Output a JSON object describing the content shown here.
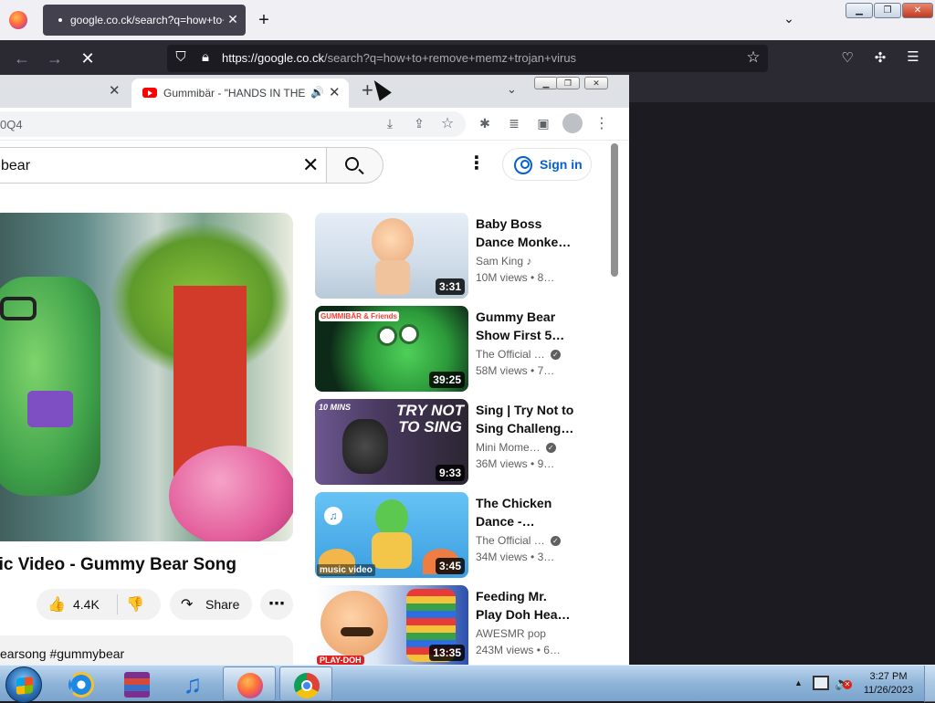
{
  "firefox": {
    "tab": {
      "title": "google.co.ck/search?q=how+to+remove+memz+trojan+virus",
      "close": "✕"
    },
    "new_tab": "+",
    "list_tabs": "⌄",
    "window_controls": {
      "minimize": "▁",
      "maximize": "❐",
      "close": "✕"
    },
    "nav": {
      "back": "←",
      "forward": "→",
      "stop": "✕"
    },
    "url": {
      "host": "https://google.co.ck",
      "path": "/search?q=how+to+remove+memz+trojan+virus"
    },
    "icons": {
      "shield": "shield-icon",
      "lock": "lock-icon",
      "bookmark": "☆",
      "pocket": "pocket-icon",
      "extensions": "puzzle-icon",
      "menu": "☰"
    }
  },
  "chrome": {
    "prev_tab_close": "✕",
    "tab": {
      "title": "Gummibär - \"HANDS IN THE AIR\"",
      "audio": "🔊",
      "close": "✕"
    },
    "new_tab": "+",
    "tab_search": "⌄",
    "window_controls": {
      "minimize": "▁",
      "maximize": "❐",
      "close": "✕"
    },
    "omnibox_text": "0Q4",
    "toolbar_icons": {
      "install": "⤓",
      "share": "⇪",
      "star": "☆",
      "extensions": "✱",
      "media": "≣",
      "sidepanel": "▣",
      "menu": "⋮"
    }
  },
  "youtube": {
    "search_query": "bear",
    "search_clear": "✕",
    "more": "⋮",
    "sign_in": "Sign in",
    "video_title": "sic Video - Gummy Bear Song",
    "like_count": "4.4K",
    "like_icon": "👍",
    "dislike_icon": "👎",
    "share": "Share",
    "share_icon": "↷",
    "actions_more": "⋯",
    "description_tags": "earsong #gummybear",
    "recommendations": [
      {
        "title": "Baby Boss Dance Monke…",
        "channel": "Sam King ♪",
        "verified": false,
        "views": "10M views",
        "age": "• 8…",
        "duration": "3:31",
        "thumb_colors": [
          "#dbe7f1",
          "#f2c99a"
        ]
      },
      {
        "title": "Gummy Bear Show First 5…",
        "channel": "The Official …",
        "verified": true,
        "views": "58M views",
        "age": "• 7…",
        "duration": "39:25",
        "thumb_colors": [
          "#0c2a1a",
          "#3fbf4a"
        ]
      },
      {
        "title": "Sing | Try Not to Sing Challeng…",
        "channel": "Mini Mome…",
        "verified": true,
        "views": "36M views",
        "age": "• 9…",
        "duration": "9:33",
        "thumb_colors": [
          "#5b3f7a",
          "#2a2430"
        ]
      },
      {
        "title": "The Chicken Dance -…",
        "channel": "The Official …",
        "verified": true,
        "views": "34M views",
        "age": "• 3…",
        "duration": "3:45",
        "thumb_colors": [
          "#56b6f0",
          "#f3c14a"
        ]
      },
      {
        "title": "Feeding Mr. Play Doh Hea…",
        "channel": "AWESMR pop",
        "verified": false,
        "views": "243M views",
        "age": "• 6…",
        "duration": "13:35",
        "thumb_colors": [
          "#3d5fbf",
          "#f29a3a"
        ]
      }
    ],
    "thumb_texts": {
      "rec2_badge": "GUMMIBÄR & Friends",
      "rec3_corner": "10 MINS",
      "rec3_big": "TRY NOT TO SING",
      "rec4_label": "music video",
      "rec5_badge": "PLAY-DOH"
    }
  },
  "taskbar": {
    "items": [
      "start",
      "internet-explorer",
      "winrar",
      "itunes",
      "firefox",
      "chrome"
    ],
    "tray_arrow": "▲",
    "time": "3:27 PM",
    "date": "11/26/2023"
  }
}
